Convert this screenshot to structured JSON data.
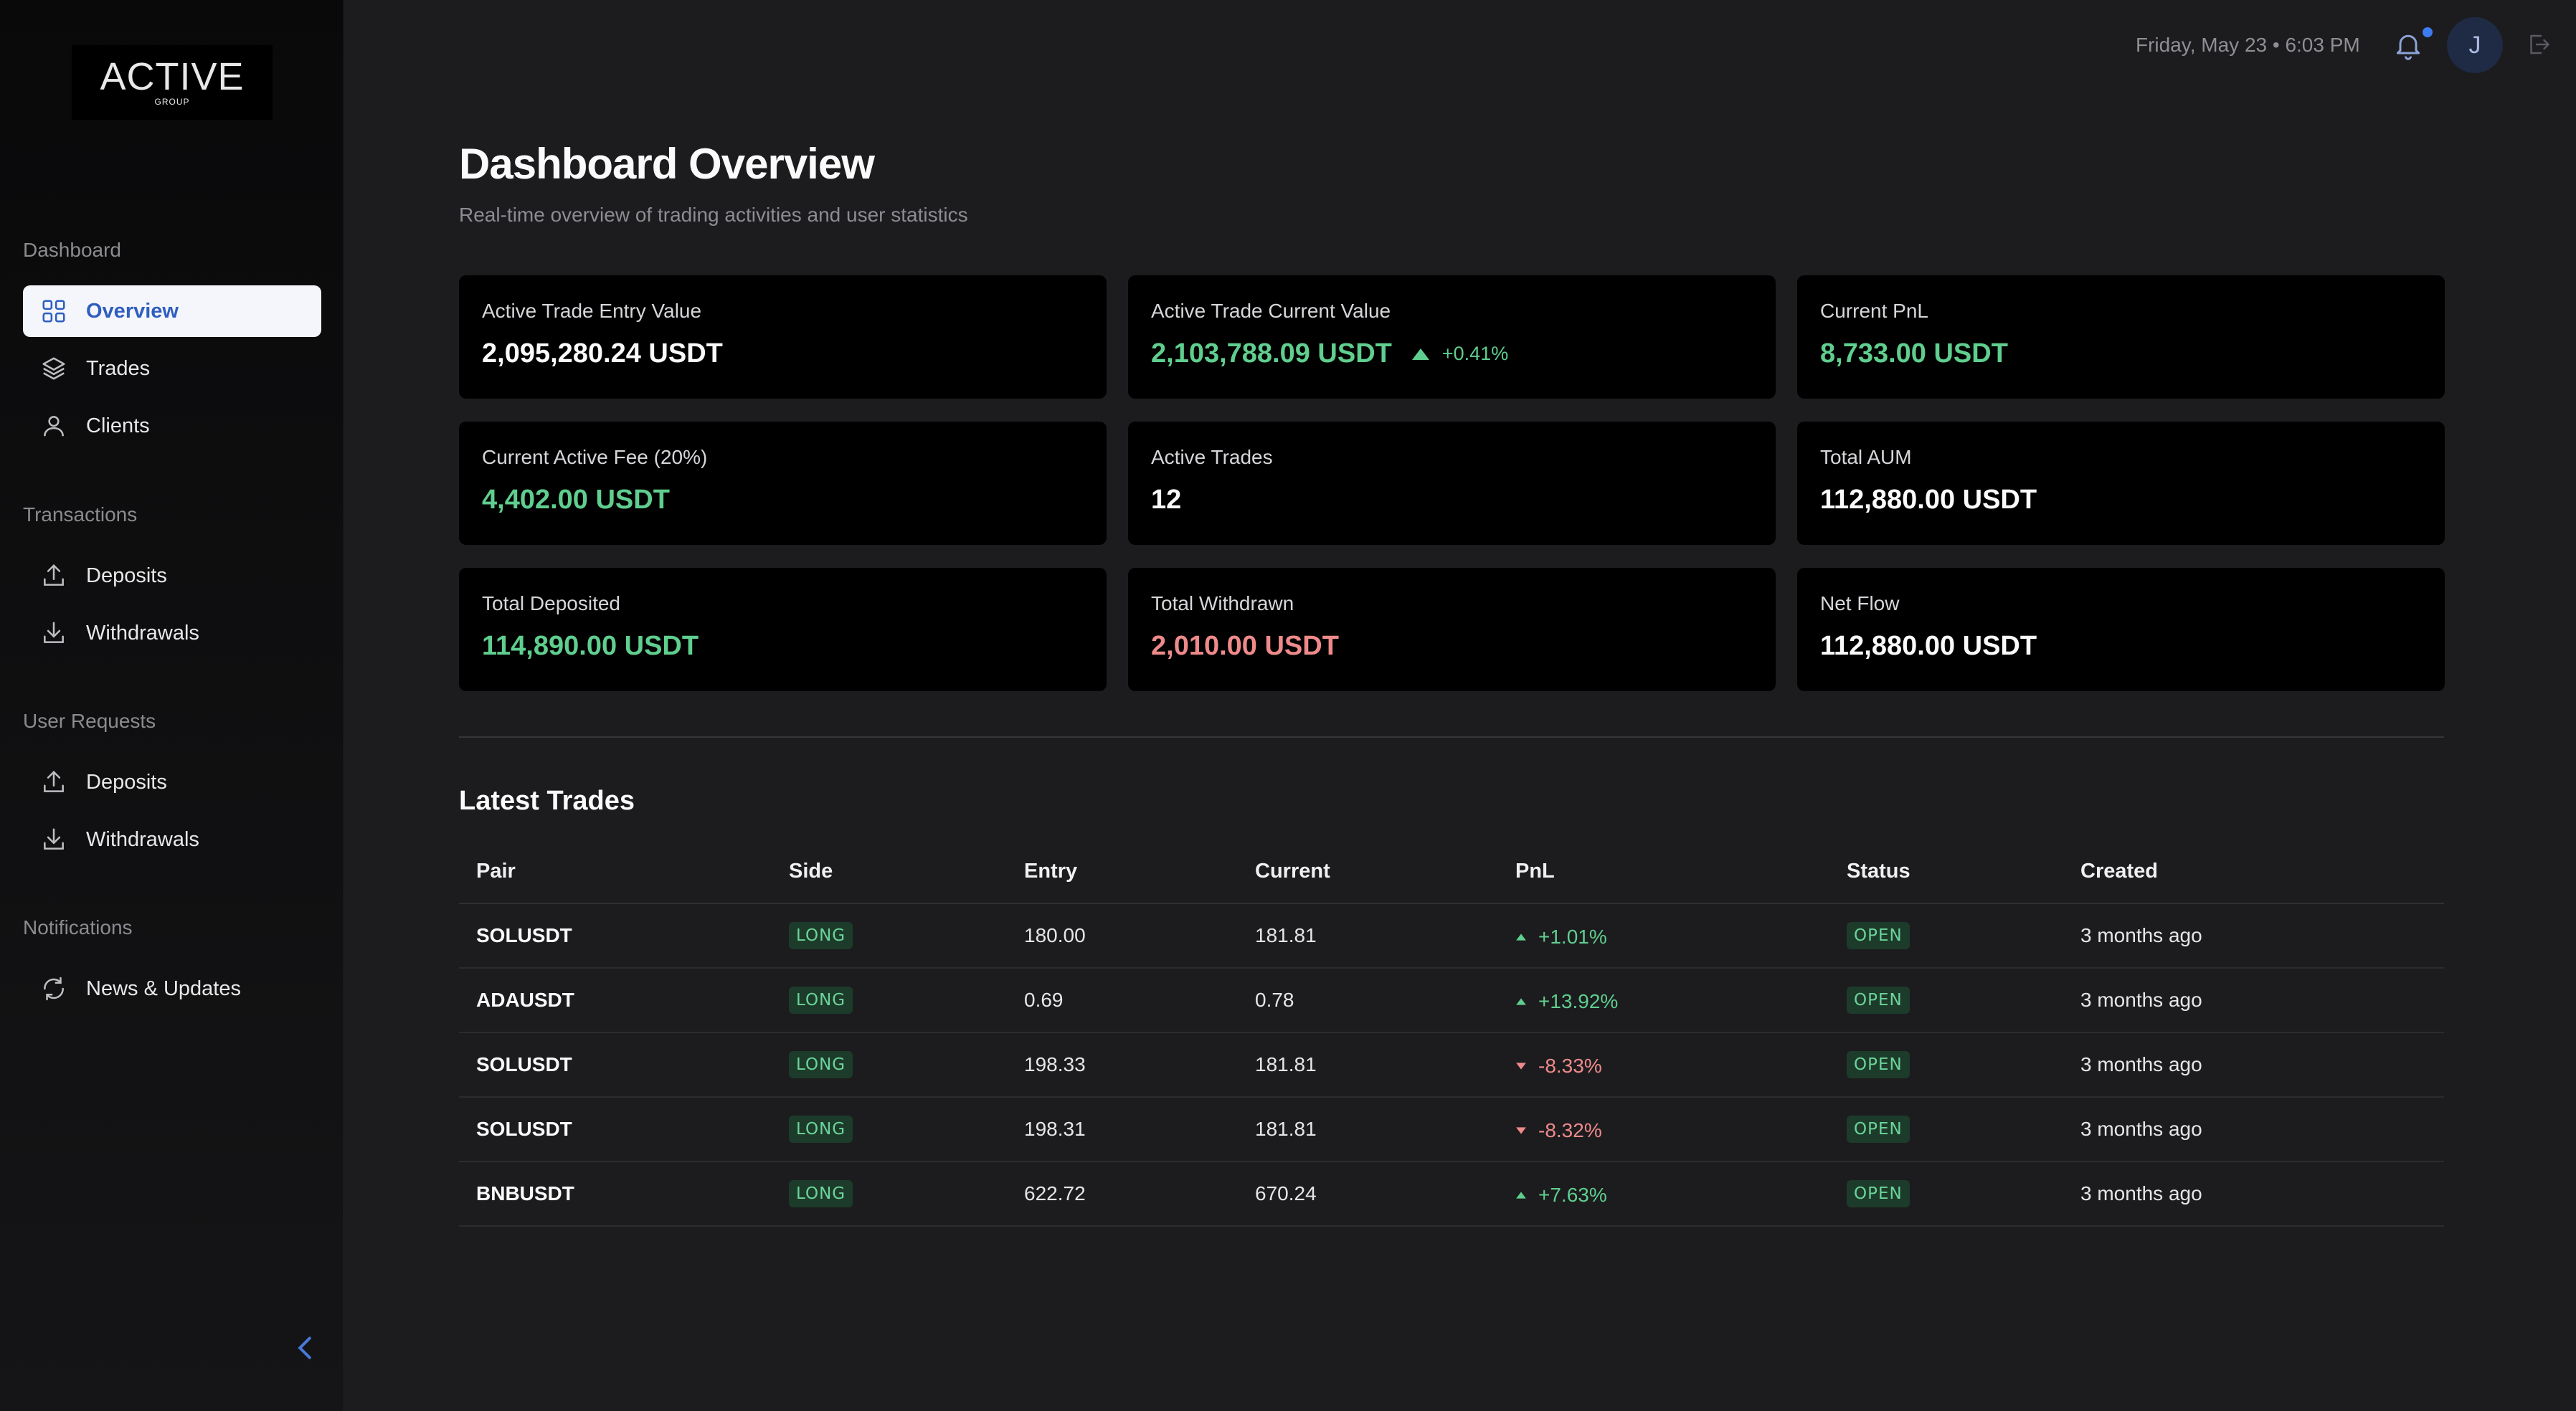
{
  "logo": {
    "main": "ACTIVE",
    "sub": "GROUP"
  },
  "sidebar": {
    "sections": [
      {
        "label": "Dashboard",
        "items": [
          {
            "label": "Overview",
            "icon": "grid-icon",
            "active": true
          },
          {
            "label": "Trades",
            "icon": "layers-icon"
          },
          {
            "label": "Clients",
            "icon": "user-icon"
          }
        ]
      },
      {
        "label": "Transactions",
        "items": [
          {
            "label": "Deposits",
            "icon": "upload-icon"
          },
          {
            "label": "Withdrawals",
            "icon": "download-icon"
          }
        ]
      },
      {
        "label": "User Requests",
        "items": [
          {
            "label": "Deposits",
            "icon": "upload-icon"
          },
          {
            "label": "Withdrawals",
            "icon": "download-icon"
          }
        ]
      },
      {
        "label": "Notifications",
        "items": [
          {
            "label": "News & Updates",
            "icon": "refresh-icon"
          }
        ]
      }
    ]
  },
  "topbar": {
    "datetime": "Friday, May 23 • 6:03 PM",
    "avatar_initial": "J"
  },
  "header": {
    "title": "Dashboard Overview",
    "subtitle": "Real-time overview of trading activities and user statistics"
  },
  "cards": [
    {
      "label": "Active Trade Entry Value",
      "value": "2,095,280.24 USDT",
      "color": "default"
    },
    {
      "label": "Active Trade Current Value",
      "value": "2,103,788.09 USDT",
      "color": "green",
      "change": "+0.41%"
    },
    {
      "label": "Current PnL",
      "value": "8,733.00 USDT",
      "color": "green"
    },
    {
      "label": "Current Active Fee (20%)",
      "value": "4,402.00 USDT",
      "color": "green"
    },
    {
      "label": "Active Trades",
      "value": "12",
      "color": "default"
    },
    {
      "label": "Total AUM",
      "value": "112,880.00 USDT",
      "color": "default"
    },
    {
      "label": "Total Deposited",
      "value": "114,890.00 USDT",
      "color": "green"
    },
    {
      "label": "Total Withdrawn",
      "value": "2,010.00 USDT",
      "color": "red"
    },
    {
      "label": "Net Flow",
      "value": "112,880.00 USDT",
      "color": "default"
    }
  ],
  "latest_trades": {
    "title": "Latest Trades",
    "columns": [
      "Pair",
      "Side",
      "Entry",
      "Current",
      "PnL",
      "Status",
      "Created"
    ],
    "rows": [
      {
        "pair": "SOLUSDT",
        "side": "LONG",
        "entry": "180.00",
        "current": "181.81",
        "pnl": "+1.01%",
        "direction": "up",
        "status": "OPEN",
        "created": "3 months ago"
      },
      {
        "pair": "ADAUSDT",
        "side": "LONG",
        "entry": "0.69",
        "current": "0.78",
        "pnl": "+13.92%",
        "direction": "up",
        "status": "OPEN",
        "created": "3 months ago"
      },
      {
        "pair": "SOLUSDT",
        "side": "LONG",
        "entry": "198.33",
        "current": "181.81",
        "pnl": "-8.33%",
        "direction": "down",
        "status": "OPEN",
        "created": "3 months ago"
      },
      {
        "pair": "SOLUSDT",
        "side": "LONG",
        "entry": "198.31",
        "current": "181.81",
        "pnl": "-8.32%",
        "direction": "down",
        "status": "OPEN",
        "created": "3 months ago"
      },
      {
        "pair": "BNBUSDT",
        "side": "LONG",
        "entry": "622.72",
        "current": "670.24",
        "pnl": "+7.63%",
        "direction": "up",
        "status": "OPEN",
        "created": "3 months ago"
      }
    ]
  },
  "colors": {
    "accent": "#2f5ebf",
    "positive": "#5fce8e",
    "negative": "#ee8a8a",
    "notification_dot": "#3d7bf0"
  }
}
